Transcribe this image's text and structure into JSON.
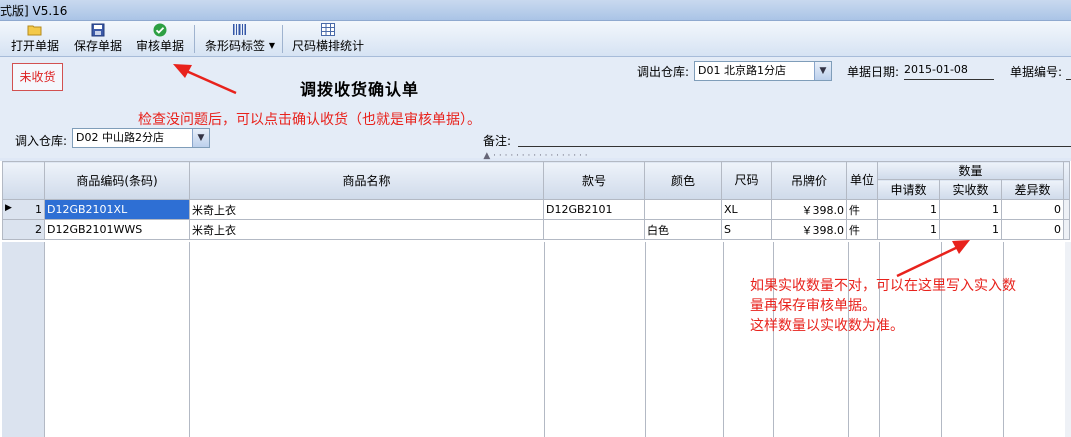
{
  "titlebar": {
    "text": "式版] V5.16"
  },
  "toolbar": {
    "open_label": "打开单据",
    "save_label": "保存单据",
    "audit_label": "审核单据",
    "barcode_label": "条形码标签",
    "size_label": "尺码横排统计"
  },
  "form": {
    "status": "未收货",
    "title": "调拨收货确认单",
    "out_warehouse_label": "调出仓库:",
    "out_warehouse_value": "D01 北京路1分店",
    "date_label": "单据日期:",
    "date_value": "2015-01-08",
    "docno_label": "单据编号:",
    "in_warehouse_label": "调入仓库:",
    "in_warehouse_value": "D02 中山路2分店",
    "remark_label": "备注:"
  },
  "annotations": {
    "top": "检查没问题后，可以点击确认收货（也就是审核单据）。",
    "grid_line1": "如果实收数量不对，可以在这里写入实入数",
    "grid_line2": "量再保存审核单据。",
    "grid_line3": "这样数量以实收数为准。"
  },
  "grid": {
    "headers": {
      "code": "商品编码(条码)",
      "name": "商品名称",
      "style": "款号",
      "color": "颜色",
      "size": "尺码",
      "price": "吊牌价",
      "unit": "单位",
      "qty_group": "数量",
      "qty_apply": "申请数",
      "qty_actual": "实收数",
      "qty_diff": "差异数"
    },
    "rows": [
      {
        "no": "1",
        "code": "D12GB2101XL",
        "name": "米奇上衣",
        "style": "D12GB2101",
        "color": "",
        "size": "XL",
        "price": "￥398.0",
        "unit": "件",
        "apply": "1",
        "actual": "1",
        "diff": "0"
      },
      {
        "no": "2",
        "code": "D12GB2101WWS",
        "name": "米奇上衣",
        "style": "",
        "color": "白色",
        "size": "S",
        "price": "￥398.0",
        "unit": "件",
        "apply": "1",
        "actual": "1",
        "diff": "0"
      }
    ]
  },
  "colors": {
    "annotation": "#e8221c",
    "selection": "#2e6fd4",
    "background": "#dfe8f6"
  }
}
